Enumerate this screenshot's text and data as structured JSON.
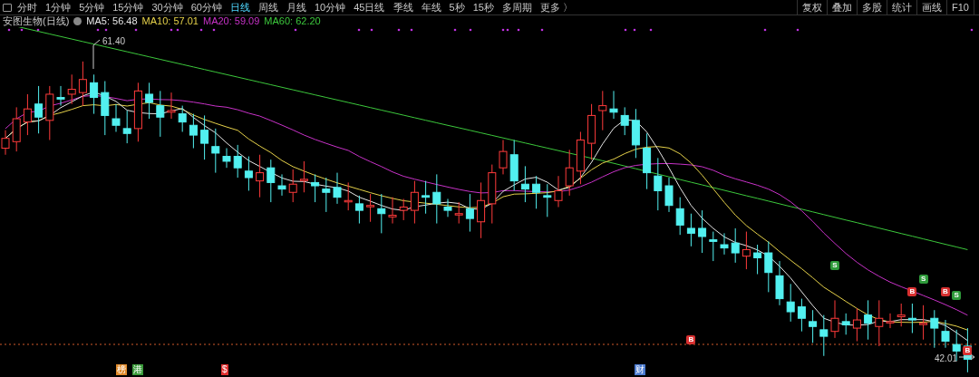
{
  "toolbar": {
    "periods": [
      {
        "label": "分时",
        "selected": false
      },
      {
        "label": "1分钟",
        "selected": false
      },
      {
        "label": "5分钟",
        "selected": false
      },
      {
        "label": "15分钟",
        "selected": false
      },
      {
        "label": "30分钟",
        "selected": false
      },
      {
        "label": "60分钟",
        "selected": false
      },
      {
        "label": "日线",
        "selected": true
      },
      {
        "label": "周线",
        "selected": false
      },
      {
        "label": "月线",
        "selected": false
      },
      {
        "label": "10分钟",
        "selected": false
      },
      {
        "label": "45日线",
        "selected": false
      },
      {
        "label": "季线",
        "selected": false
      },
      {
        "label": "年线",
        "selected": false
      },
      {
        "label": "5秒",
        "selected": false
      },
      {
        "label": "15秒",
        "selected": false
      },
      {
        "label": "多周期",
        "selected": false
      },
      {
        "label": "更多 〉",
        "selected": false
      }
    ],
    "tools": [
      "复权",
      "叠加",
      "多股",
      "统计",
      "画线",
      "F10"
    ]
  },
  "legend": {
    "stock": "安图生物(日线)",
    "indicators": [
      {
        "label": "MA5: 56.48",
        "color": "#e6e6e6"
      },
      {
        "label": "MA10: 57.01",
        "color": "#e6d24a"
      },
      {
        "label": "MA20: 59.09",
        "color": "#c832c8"
      },
      {
        "label": "MA60: 62.20",
        "color": "#3cc83c"
      }
    ]
  },
  "chart": {
    "high_label": "61.40",
    "low_label": "42.01",
    "signals": [
      {
        "kind": "buy",
        "label": "B"
      },
      {
        "kind": "sell",
        "label": "S"
      },
      {
        "kind": "buy",
        "label": "B"
      },
      {
        "kind": "sell",
        "label": "S"
      },
      {
        "kind": "buy",
        "label": "B"
      },
      {
        "kind": "sell",
        "label": "S"
      },
      {
        "kind": "buy",
        "label": "B"
      }
    ],
    "events": [
      {
        "label": "榜",
        "color": "#e08a2a"
      },
      {
        "label": "港",
        "color": "#3a9a3a"
      },
      {
        "label": "$",
        "color": "#e03030"
      },
      {
        "label": "财",
        "color": "#4a7ad0"
      }
    ]
  }
}
